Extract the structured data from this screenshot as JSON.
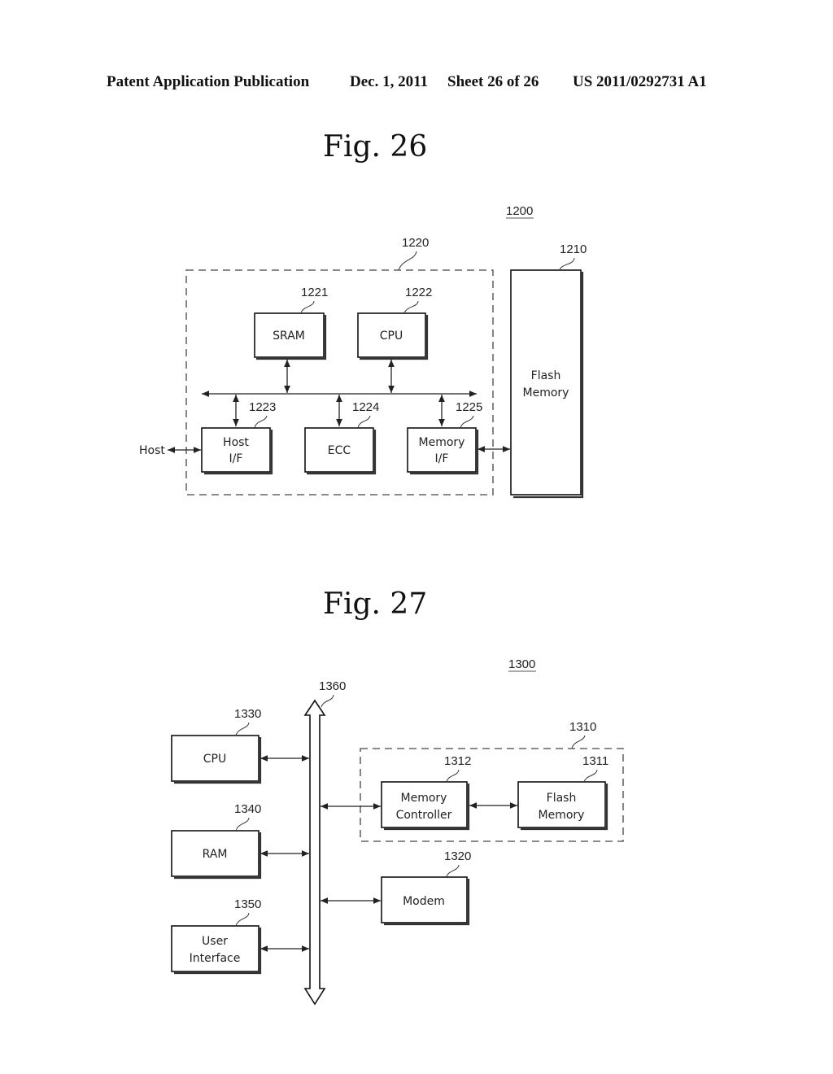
{
  "header": {
    "publication": "Patent Application Publication",
    "date": "Dec. 1, 2011",
    "sheet": "Sheet 26 of 26",
    "number": "US 2011/0292731 A1"
  },
  "fig26": {
    "title": "Fig. 26",
    "system_ref": "1200",
    "controller_ref": "1220",
    "flash_ref": "1210",
    "flash_label": [
      "Flash",
      "Memory"
    ],
    "sram": {
      "ref": "1221",
      "label": "SRAM"
    },
    "cpu": {
      "ref": "1222",
      "label": "CPU"
    },
    "host_if": {
      "ref": "1223",
      "label": [
        "Host",
        "I/F"
      ]
    },
    "ecc": {
      "ref": "1224",
      "label": "ECC"
    },
    "memory_if": {
      "ref": "1225",
      "label": [
        "Memory",
        "I/F"
      ]
    },
    "host_label": "Host"
  },
  "fig27": {
    "title": "Fig. 27",
    "system_ref": "1300",
    "bus_ref": "1360",
    "cpu": {
      "ref": "1330",
      "label": "CPU"
    },
    "ram": {
      "ref": "1340",
      "label": "RAM"
    },
    "ui": {
      "ref": "1350",
      "label": [
        "User",
        "Interface"
      ]
    },
    "storage_ref": "1310",
    "memctrl": {
      "ref": "1312",
      "label": [
        "Memory",
        "Controller"
      ]
    },
    "flash": {
      "ref": "1311",
      "label": [
        "Flash",
        "Memory"
      ]
    },
    "modem": {
      "ref": "1320",
      "label": "Modem"
    }
  }
}
